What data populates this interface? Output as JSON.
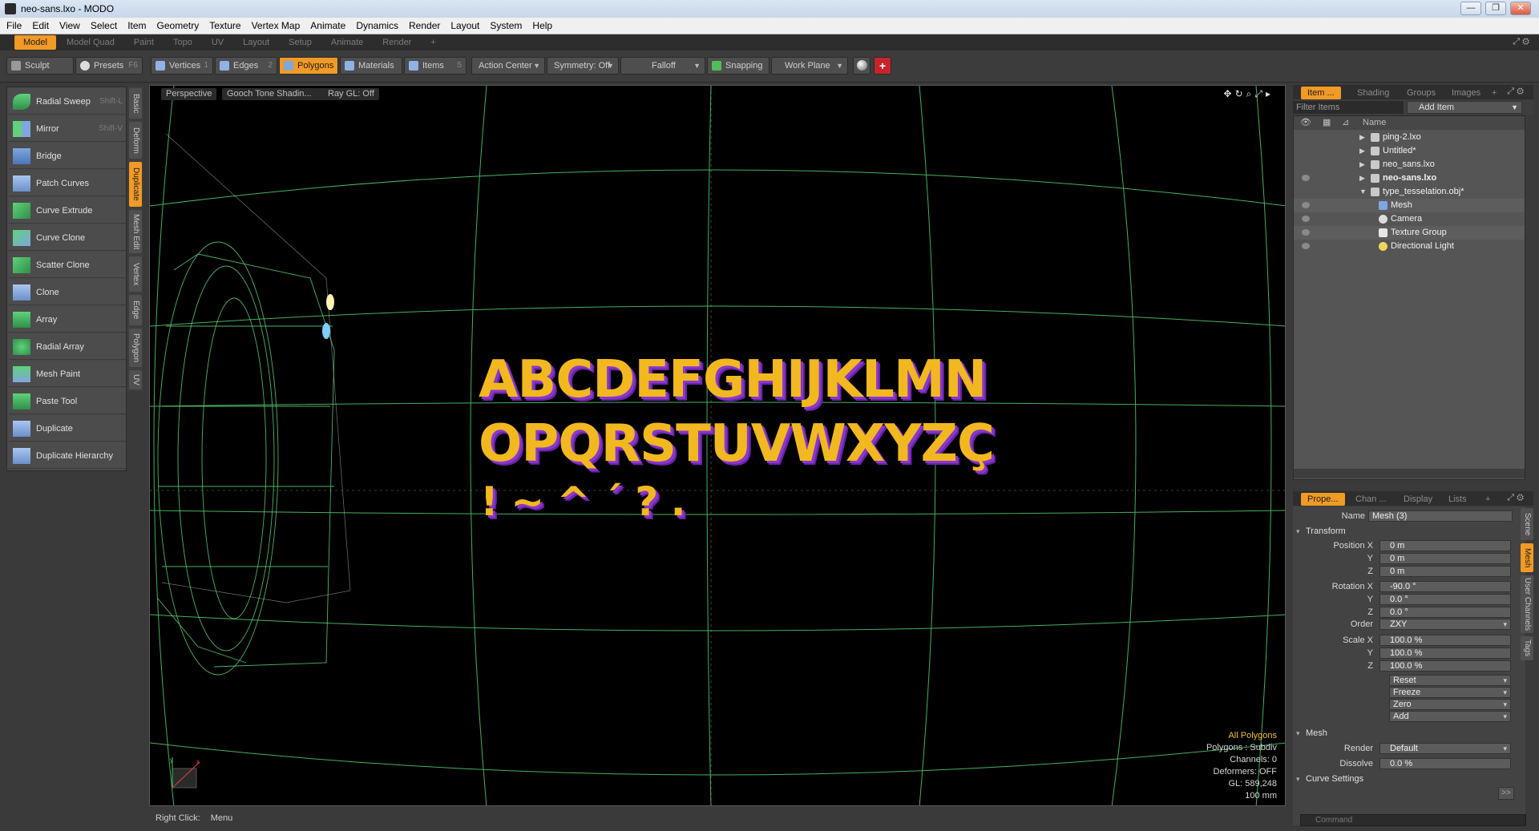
{
  "window": {
    "title": "neo-sans.lxo - MODO"
  },
  "menu": [
    "File",
    "Edit",
    "View",
    "Select",
    "Item",
    "Geometry",
    "Texture",
    "Vertex Map",
    "Animate",
    "Dynamics",
    "Render",
    "Layout",
    "System",
    "Help"
  ],
  "layout_tabs": [
    "Model",
    "Model Quad",
    "Paint",
    "Topo",
    "UV",
    "Layout",
    "Setup",
    "Animate",
    "Render",
    "+"
  ],
  "toolbar": {
    "sculpt": "Sculpt",
    "presets": "Presets",
    "presets_shortcut": "F6",
    "vertices": "Vertices",
    "vertices_key": "1",
    "edges": "Edges",
    "edges_key": "2",
    "polygons": "Polygons",
    "materials": "Materials",
    "items": "Items",
    "items_key": "5",
    "action_center": "Action Center",
    "symmetry": "Symmetry: Off",
    "falloff": "Falloff",
    "snapping": "Snapping",
    "work_plane": "Work Plane"
  },
  "tools": [
    {
      "label": "Radial Sweep",
      "shortcut": "Shift-L"
    },
    {
      "label": "Mirror",
      "shortcut": "Shift-V"
    },
    {
      "label": "Bridge",
      "shortcut": ""
    },
    {
      "label": "Patch Curves",
      "shortcut": ""
    },
    {
      "label": "Curve Extrude",
      "shortcut": ""
    },
    {
      "label": "Curve Clone",
      "shortcut": ""
    },
    {
      "label": "Scatter Clone",
      "shortcut": ""
    },
    {
      "label": "Clone",
      "shortcut": ""
    },
    {
      "label": "Array",
      "shortcut": ""
    },
    {
      "label": "Radial Array",
      "shortcut": ""
    },
    {
      "label": "Mesh Paint",
      "shortcut": ""
    },
    {
      "label": "Paste Tool",
      "shortcut": ""
    },
    {
      "label": "Duplicate",
      "shortcut": ""
    },
    {
      "label": "Duplicate Hierarchy",
      "shortcut": ""
    }
  ],
  "side_tabs": [
    "Basic",
    "Deform",
    "Duplicate",
    "Mesh Edit",
    "Vertex",
    "Edge",
    "Polygon",
    "UV"
  ],
  "viewport": {
    "view": "Perspective",
    "shading": "Gooch Tone Shadin...",
    "raygl": "Ray GL: Off",
    "text_line1": "ABCDEFGHIJKLMN",
    "text_line2": "OPQRSTUVWXYZÇ",
    "text_line3": "! ~ ^ ´ ? .",
    "hud": {
      "line1": "All Polygons",
      "line2": "Polygons : Subdiv",
      "line3": "Channels: 0",
      "line4": "Deformers: OFF",
      "line5": "GL: 589,248",
      "line6": "100 mm"
    }
  },
  "status": {
    "hint_key": "Right Click:",
    "hint_action": "Menu"
  },
  "items_panel": {
    "tabs": [
      "Item ...",
      "Shading",
      "Groups",
      "Images",
      "+"
    ],
    "filter_placeholder": "Filter Items",
    "add_item": "Add Item",
    "column_name": "Name",
    "rows": [
      {
        "name": "ping-2.lxo",
        "bold": false
      },
      {
        "name": "Untitled*",
        "bold": false
      },
      {
        "name": "neo_sans.lxo",
        "bold": false
      },
      {
        "name": "neo-sans.lxo",
        "bold": true
      },
      {
        "name": "type_tesselation.obj*",
        "bold": false
      },
      {
        "name": "Mesh",
        "bold": false
      },
      {
        "name": "Camera",
        "bold": false
      },
      {
        "name": "Texture Group",
        "bold": false
      },
      {
        "name": "Directional Light",
        "bold": false
      }
    ]
  },
  "props_panel": {
    "tabs": [
      "Prope...",
      "Chan ...",
      "Display",
      "Lists",
      "+"
    ],
    "name_label": "Name",
    "name_value": "Mesh (3)",
    "transform_label": "Transform",
    "position_x_label": "Position X",
    "position_x": "0 m",
    "position_y": "0 m",
    "position_z": "0 m",
    "rotation_x_label": "Rotation X",
    "rotation_x": "-90.0 °",
    "rotation_y": "0.0 °",
    "rotation_z": "0.0 °",
    "order_label": "Order",
    "order_value": "ZXY",
    "scale_x_label": "Scale X",
    "scale_x": "100.0 %",
    "scale_y": "100.0 %",
    "scale_z": "100.0 %",
    "y_label": "Y",
    "z_label": "Z",
    "reset": "Reset",
    "freeze": "Freeze",
    "zero": "Zero",
    "add": "Add",
    "mesh_label": "Mesh",
    "render_label": "Render",
    "render_value": "Default",
    "dissolve_label": "Dissolve",
    "dissolve_value": "0.0 %",
    "curve_settings": "Curve Settings",
    "side_tabs": [
      "Scene",
      "Mesh",
      "User Channels",
      "Tags"
    ],
    "command_placeholder": "Command"
  },
  "colors": {
    "accent": "#f19a25",
    "letters": "#f2b81f",
    "letters_shadow": "#8a36cf",
    "grid": "#5fd07a"
  }
}
